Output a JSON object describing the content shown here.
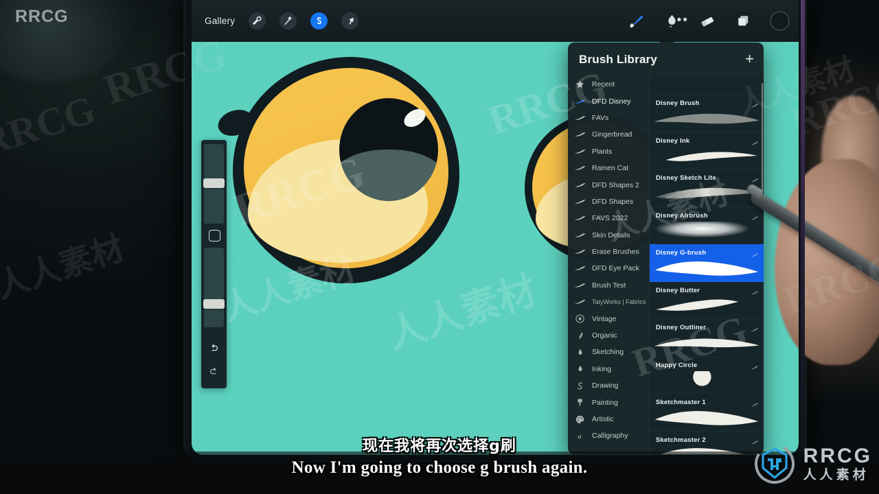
{
  "colors": {
    "canvas": "#5ad0bd",
    "accent_blue": "#1560e8",
    "panel_bg": "#182528",
    "iris": "#f4bf49",
    "outline": "#101c20",
    "lower_lid": "#f7e4a0",
    "pupil_sheen": "#4b6260",
    "logo_blue": "#2aa3e0"
  },
  "watermark": {
    "brand": "RRCG",
    "brand_cn": "人人素材"
  },
  "topbar": {
    "gallery_label": "Gallery",
    "icons": [
      {
        "name": "wrench-icon",
        "glyph": "wrench",
        "active": false
      },
      {
        "name": "magic-wand-icon",
        "glyph": "wand",
        "active": false
      },
      {
        "name": "selection-s-icon",
        "glyph": "ess",
        "active": true
      },
      {
        "name": "transform-arrow-icon",
        "glyph": "arrow",
        "active": false
      }
    ],
    "more_label": "•••",
    "right_icons": [
      {
        "name": "brush-icon",
        "glyph": "brush",
        "active": true
      },
      {
        "name": "smudge-icon",
        "glyph": "smudge",
        "active": false
      },
      {
        "name": "eraser-icon",
        "glyph": "eraser",
        "active": false
      },
      {
        "name": "layers-icon",
        "glyph": "layers",
        "active": false
      },
      {
        "name": "color-swatch",
        "glyph": "circle",
        "active": false
      }
    ]
  },
  "rail": {
    "brush_size_label": "brush-size-slider",
    "modify_label": "modify-button",
    "opacity_label": "opacity-slider",
    "undo_label": "undo-button",
    "redo_label": "redo-button"
  },
  "panel": {
    "title": "Brush Library",
    "add_label": "+",
    "sets": [
      {
        "label": "Recent",
        "icon": "star-icon",
        "selected": false,
        "small": false
      },
      {
        "label": "DFD Disney",
        "icon": "brush-blue-icon",
        "selected": true,
        "small": false
      },
      {
        "label": "FAVs",
        "icon": "brush-icon",
        "selected": false,
        "small": false
      },
      {
        "label": "Gingerbread",
        "icon": "brush-icon",
        "selected": false,
        "small": false
      },
      {
        "label": "Plants",
        "icon": "brush-icon",
        "selected": false,
        "small": false
      },
      {
        "label": "Ramen Cat",
        "icon": "brush-icon",
        "selected": false,
        "small": false
      },
      {
        "label": "DFD Shapes 2",
        "icon": "brush-icon",
        "selected": false,
        "small": false
      },
      {
        "label": "DFD Shapes",
        "icon": "brush-icon",
        "selected": false,
        "small": false
      },
      {
        "label": "FAVS 2022",
        "icon": "brush-icon",
        "selected": false,
        "small": false
      },
      {
        "label": "Skin Details",
        "icon": "brush-icon",
        "selected": false,
        "small": false
      },
      {
        "label": "Erase Brushes",
        "icon": "brush-icon",
        "selected": false,
        "small": false
      },
      {
        "label": "DFD Eye Pack",
        "icon": "brush-icon",
        "selected": false,
        "small": false
      },
      {
        "label": "Brush Test",
        "icon": "brush-icon",
        "selected": false,
        "small": false
      },
      {
        "label": "TatyWorks | Fabrics",
        "icon": "brush-icon",
        "selected": false,
        "small": true
      },
      {
        "label": "Vintage",
        "icon": "star-circle-icon",
        "selected": false,
        "small": false
      },
      {
        "label": "Organic",
        "icon": "leaf-icon",
        "selected": false,
        "small": false
      },
      {
        "label": "Sketching",
        "icon": "pencil-tip-icon",
        "selected": false,
        "small": false
      },
      {
        "label": "Inking",
        "icon": "ink-drop-icon",
        "selected": false,
        "small": false
      },
      {
        "label": "Drawing",
        "icon": "scribble-icon",
        "selected": false,
        "small": false
      },
      {
        "label": "Painting",
        "icon": "paintbrush-icon",
        "selected": false,
        "small": false
      },
      {
        "label": "Artistic",
        "icon": "palette-icon",
        "selected": false,
        "small": false
      },
      {
        "label": "Calligraphy",
        "icon": "letter-a-icon",
        "selected": false,
        "small": false
      }
    ],
    "brushes": [
      {
        "label": "",
        "selected": false,
        "shape": "partial"
      },
      {
        "label": "Disney Brush",
        "selected": false,
        "shape": "wide-taper"
      },
      {
        "label": "Disney Ink",
        "selected": false,
        "shape": "ink-swoosh"
      },
      {
        "label": "Disney Sketch Lite",
        "selected": false,
        "shape": "sketch-soft"
      },
      {
        "label": "Disney Airbrush",
        "selected": false,
        "shape": "airbrush-blob"
      },
      {
        "label": "Disney G-brush",
        "selected": true,
        "shape": "leaf-taper"
      },
      {
        "label": "Disney Butter",
        "selected": false,
        "shape": "butter-swoosh"
      },
      {
        "label": "Disney Outliner",
        "selected": false,
        "shape": "thin-taper"
      },
      {
        "label": "Happy Circle",
        "selected": false,
        "shape": "circle"
      },
      {
        "label": "Sketchmaster 1",
        "selected": false,
        "shape": "leaf-taper"
      },
      {
        "label": "Sketchmaster 2",
        "selected": false,
        "shape": "leaf-taper"
      }
    ]
  },
  "subtitles": {
    "chinese": "现在我将再次选择g刷",
    "english": "Now I'm going to choose g brush again."
  },
  "logo": {
    "text": "RRCG",
    "text_cn": "人人素材"
  }
}
